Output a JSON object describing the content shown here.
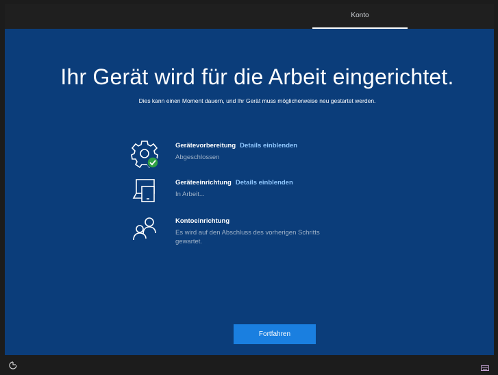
{
  "topbar": {
    "tab_label": "Konto"
  },
  "header": {
    "title": "Ihr Gerät wird für die Arbeit eingerichtet.",
    "subtitle": "Dies kann einen Moment dauern, und Ihr Gerät muss möglicherweise neu gestartet werden."
  },
  "steps": [
    {
      "name": "Gerätevorbereitung",
      "link": "Details einblenden",
      "status": "Abgeschlossen",
      "icon": "gear-check-icon"
    },
    {
      "name": "Geräteeinrichtung",
      "link": "Details einblenden",
      "status": "In Arbeit...",
      "icon": "devices-icon"
    },
    {
      "name": "Kontoeinrichtung",
      "status_line1": "Es wird auf den Abschluss des vorherigen Schritts",
      "status_line2": "gewartet.",
      "icon": "people-icon"
    }
  ],
  "actions": {
    "continue_label": "Fortfahren"
  },
  "colors": {
    "background": "#0b3d7a",
    "accent": "#1a7fe0",
    "link": "#8fc7ff",
    "success": "#2ea043"
  },
  "icons": {
    "bottom_left": "accessibility-icon",
    "bottom_right": "keyboard-icon"
  }
}
